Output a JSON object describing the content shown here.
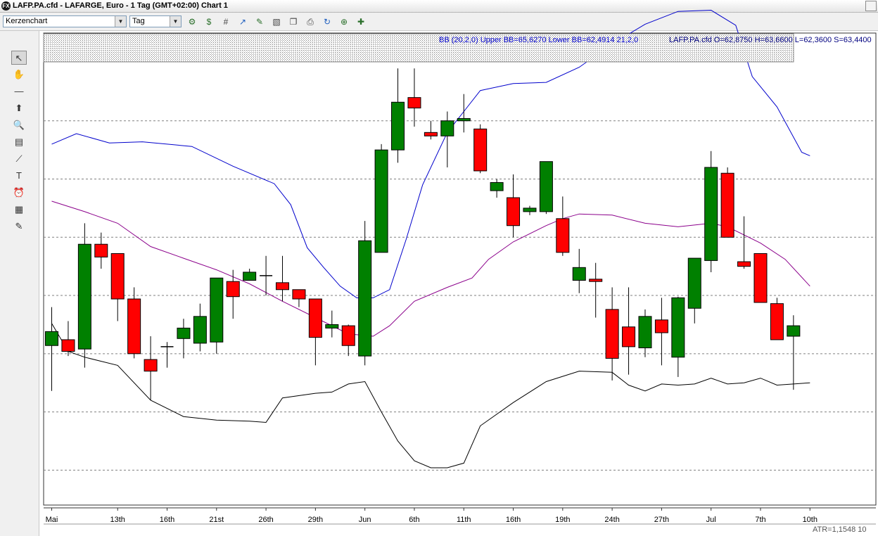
{
  "window": {
    "title": "LAFP.PA.cfd - LAFARGE, Euro - 1 Tag (GMT+02:00)   Chart 1"
  },
  "toolbar": {
    "chart_type": "Kerzenchart",
    "interval": "Tag",
    "buttons": [
      "add-indicator-icon",
      "add-study-icon",
      "grid-icon",
      "trend-icon",
      "edit-icon",
      "draw-icon",
      "copy-icon",
      "print-icon",
      "refresh-icon",
      "zoom-icon",
      "settings-icon"
    ]
  },
  "sidebar": {
    "tools": [
      {
        "name": "pointer-tool",
        "glyph": "↖",
        "selected": true
      },
      {
        "name": "hand-tool",
        "glyph": "✋"
      },
      {
        "name": "line-tool",
        "glyph": "—"
      },
      {
        "name": "arrow-tool",
        "glyph": "⬆"
      },
      {
        "name": "zoom-tool",
        "glyph": "🔍"
      },
      {
        "name": "fibonacci-tool",
        "glyph": "▤"
      },
      {
        "name": "fan-tool",
        "glyph": "⟋"
      },
      {
        "name": "text-tool",
        "glyph": "T"
      },
      {
        "name": "alarm-tool",
        "glyph": "⏰"
      },
      {
        "name": "calculator-tool",
        "glyph": "▦"
      },
      {
        "name": "paint-tool",
        "glyph": "✎"
      }
    ]
  },
  "legend": {
    "bands_text": "BB (20,2,0) Upper BB=65,6270 Lower BB=62,4914 21,2,0",
    "ohlc_text": "LAFP.PA.cfd O=62,8750 H=63,6600 L=62,3600 S=63,4400"
  },
  "footer": {
    "atr_text": "ATR=1,1548  10"
  },
  "colors": {
    "up": "#008000",
    "down": "#ff0000",
    "upper_band": "#0000cc",
    "middle_band": "#8b008b",
    "lower_band": "#000000",
    "grid": "#808080"
  },
  "chart_data": {
    "type": "candlestick",
    "x_labels": [
      {
        "label": "Mai",
        "i": 0
      },
      {
        "label": "13th",
        "i": 4
      },
      {
        "label": "16th",
        "i": 7
      },
      {
        "label": "21st",
        "i": 10
      },
      {
        "label": "26th",
        "i": 13
      },
      {
        "label": "29th",
        "i": 16
      },
      {
        "label": "Jun",
        "i": 19
      },
      {
        "label": "6th",
        "i": 22
      },
      {
        "label": "11th",
        "i": 25
      },
      {
        "label": "16th",
        "i": 28
      },
      {
        "label": "19th",
        "i": 31
      },
      {
        "label": "24th",
        "i": 34
      },
      {
        "label": "27th",
        "i": 37
      },
      {
        "label": "Jul",
        "i": 40
      },
      {
        "label": "7th",
        "i": 43
      },
      {
        "label": "10th",
        "i": 46
      }
    ],
    "ylim": [
      61.7,
      65.5
    ],
    "grid_y": [
      62.0,
      62.5,
      63.0,
      63.5,
      64.0,
      64.5,
      65.0
    ],
    "candles": [
      {
        "o": 63.07,
        "h": 63.4,
        "l": 62.68,
        "c": 63.19
      },
      {
        "o": 63.12,
        "h": 63.28,
        "l": 62.98,
        "c": 63.02
      },
      {
        "o": 63.04,
        "h": 64.12,
        "l": 62.88,
        "c": 63.94
      },
      {
        "o": 63.94,
        "h": 64.04,
        "l": 63.73,
        "c": 63.83
      },
      {
        "o": 63.86,
        "h": 63.86,
        "l": 63.28,
        "c": 63.47
      },
      {
        "o": 63.47,
        "h": 63.57,
        "l": 62.96,
        "c": 63.0
      },
      {
        "o": 62.95,
        "h": 63.15,
        "l": 62.6,
        "c": 62.85
      },
      {
        "o": 63.06,
        "h": 63.1,
        "l": 62.88,
        "c": 63.06
      },
      {
        "o": 63.13,
        "h": 63.3,
        "l": 62.96,
        "c": 63.22
      },
      {
        "o": 63.09,
        "h": 63.43,
        "l": 63.02,
        "c": 63.32
      },
      {
        "o": 63.1,
        "h": 63.65,
        "l": 63.0,
        "c": 63.65
      },
      {
        "o": 63.62,
        "h": 63.72,
        "l": 63.3,
        "c": 63.49
      },
      {
        "o": 63.63,
        "h": 63.73,
        "l": 63.63,
        "c": 63.7
      },
      {
        "o": 63.67,
        "h": 63.84,
        "l": 63.5,
        "c": 63.67
      },
      {
        "o": 63.61,
        "h": 63.84,
        "l": 63.45,
        "c": 63.55
      },
      {
        "o": 63.55,
        "h": 63.5,
        "l": 63.4,
        "c": 63.47
      },
      {
        "o": 63.47,
        "h": 63.47,
        "l": 62.9,
        "c": 63.14
      },
      {
        "o": 63.22,
        "h": 63.37,
        "l": 63.14,
        "c": 63.25
      },
      {
        "o": 63.24,
        "h": 63.25,
        "l": 62.98,
        "c": 63.07
      },
      {
        "o": 62.98,
        "h": 64.14,
        "l": 62.9,
        "c": 63.97
      },
      {
        "o": 63.87,
        "h": 64.8,
        "l": 63.87,
        "c": 64.75
      },
      {
        "o": 64.75,
        "h": 65.45,
        "l": 64.64,
        "c": 65.16
      },
      {
        "o": 65.2,
        "h": 65.45,
        "l": 64.95,
        "c": 65.11
      },
      {
        "o": 64.9,
        "h": 65.0,
        "l": 64.84,
        "c": 64.87
      },
      {
        "o": 64.87,
        "h": 65.08,
        "l": 64.6,
        "c": 65.0
      },
      {
        "o": 65.0,
        "h": 65.23,
        "l": 64.9,
        "c": 65.02
      },
      {
        "o": 64.93,
        "h": 64.97,
        "l": 64.55,
        "c": 64.57
      },
      {
        "o": 64.4,
        "h": 64.5,
        "l": 64.34,
        "c": 64.47
      },
      {
        "o": 64.34,
        "h": 64.54,
        "l": 64.0,
        "c": 64.1
      },
      {
        "o": 64.22,
        "h": 64.27,
        "l": 64.19,
        "c": 64.25
      },
      {
        "o": 64.22,
        "h": 64.6,
        "l": 64.2,
        "c": 64.65
      },
      {
        "o": 64.16,
        "h": 64.35,
        "l": 63.84,
        "c": 63.87
      },
      {
        "o": 63.63,
        "h": 63.9,
        "l": 63.52,
        "c": 63.74
      },
      {
        "o": 63.64,
        "h": 63.78,
        "l": 63.31,
        "c": 63.62
      },
      {
        "o": 63.38,
        "h": 63.57,
        "l": 62.77,
        "c": 62.96
      },
      {
        "o": 63.23,
        "h": 63.57,
        "l": 62.82,
        "c": 63.06
      },
      {
        "o": 63.05,
        "h": 63.38,
        "l": 62.97,
        "c": 63.32
      },
      {
        "o": 63.29,
        "h": 63.48,
        "l": 62.9,
        "c": 63.18
      },
      {
        "o": 62.97,
        "h": 63.49,
        "l": 62.8,
        "c": 63.48
      },
      {
        "o": 63.39,
        "h": 63.77,
        "l": 63.26,
        "c": 63.82
      },
      {
        "o": 63.8,
        "h": 64.74,
        "l": 63.7,
        "c": 64.6
      },
      {
        "o": 64.55,
        "h": 64.6,
        "l": 64.0,
        "c": 64.0
      },
      {
        "o": 63.79,
        "h": 64.18,
        "l": 63.73,
        "c": 63.75
      },
      {
        "o": 63.86,
        "h": 63.86,
        "l": 63.44,
        "c": 63.44
      },
      {
        "o": 63.43,
        "h": 63.48,
        "l": 63.12,
        "c": 63.12
      },
      {
        "o": 63.15,
        "h": 63.33,
        "l": 62.69,
        "c": 63.24
      }
    ],
    "upper_band": [
      [
        0,
        64.8
      ],
      [
        1.5,
        64.89
      ],
      [
        3.5,
        64.81
      ],
      [
        5.5,
        64.82
      ],
      [
        8.5,
        64.78
      ],
      [
        11,
        64.61
      ],
      [
        13.5,
        64.46
      ],
      [
        14.5,
        64.28
      ],
      [
        15.5,
        63.91
      ],
      [
        16.5,
        63.74
      ],
      [
        17.5,
        63.58
      ],
      [
        18.5,
        63.48
      ],
      [
        19.5,
        63.48
      ],
      [
        20.5,
        63.55
      ],
      [
        21.5,
        63.98
      ],
      [
        22.5,
        64.45
      ],
      [
        24,
        64.9
      ],
      [
        25,
        65.08
      ],
      [
        26,
        65.26
      ],
      [
        28,
        65.32
      ],
      [
        30,
        65.33
      ],
      [
        32,
        65.46
      ],
      [
        34,
        65.66
      ],
      [
        36,
        65.83
      ],
      [
        38,
        65.94
      ],
      [
        40,
        65.95
      ],
      [
        41.5,
        65.82
      ],
      [
        42.5,
        65.38
      ],
      [
        44,
        65.12
      ],
      [
        45.5,
        64.73
      ],
      [
        46,
        64.7
      ]
    ],
    "middle_band": [
      [
        0,
        64.31
      ],
      [
        2,
        64.22
      ],
      [
        4,
        64.12
      ],
      [
        6,
        63.92
      ],
      [
        8,
        63.82
      ],
      [
        10,
        63.72
      ],
      [
        12,
        63.6
      ],
      [
        14,
        63.45
      ],
      [
        16,
        63.31
      ],
      [
        18,
        63.17
      ],
      [
        19.5,
        63.15
      ],
      [
        20.5,
        63.24
      ],
      [
        22,
        63.45
      ],
      [
        24,
        63.57
      ],
      [
        25.5,
        63.65
      ],
      [
        26.5,
        63.81
      ],
      [
        28,
        63.96
      ],
      [
        30,
        64.1
      ],
      [
        31,
        64.16
      ],
      [
        32,
        64.2
      ],
      [
        34,
        64.19
      ],
      [
        36,
        64.12
      ],
      [
        38,
        64.09
      ],
      [
        40,
        64.12
      ],
      [
        41,
        64.09
      ],
      [
        43,
        63.95
      ],
      [
        44.5,
        63.81
      ],
      [
        46,
        63.58
      ]
    ],
    "lower_band": [
      [
        0,
        63.26
      ],
      [
        1,
        63.02
      ],
      [
        2,
        62.97
      ],
      [
        4,
        62.9
      ],
      [
        6,
        62.6
      ],
      [
        8,
        62.46
      ],
      [
        10,
        62.43
      ],
      [
        12,
        62.42
      ],
      [
        13,
        62.41
      ],
      [
        14,
        62.62
      ],
      [
        16,
        62.66
      ],
      [
        17,
        62.67
      ],
      [
        18,
        62.74
      ],
      [
        19,
        62.76
      ],
      [
        20,
        62.5
      ],
      [
        21,
        62.25
      ],
      [
        22,
        62.08
      ],
      [
        23,
        62.02
      ],
      [
        24,
        62.02
      ],
      [
        25,
        62.06
      ],
      [
        26,
        62.38
      ],
      [
        28,
        62.58
      ],
      [
        30,
        62.76
      ],
      [
        32,
        62.85
      ],
      [
        34,
        62.84
      ],
      [
        35,
        62.73
      ],
      [
        36,
        62.68
      ],
      [
        37,
        62.74
      ],
      [
        38,
        62.73
      ],
      [
        39,
        62.74
      ],
      [
        40,
        62.79
      ],
      [
        41,
        62.74
      ],
      [
        42,
        62.75
      ],
      [
        43,
        62.79
      ],
      [
        44,
        62.73
      ],
      [
        45,
        62.74
      ],
      [
        46,
        62.75
      ]
    ]
  }
}
